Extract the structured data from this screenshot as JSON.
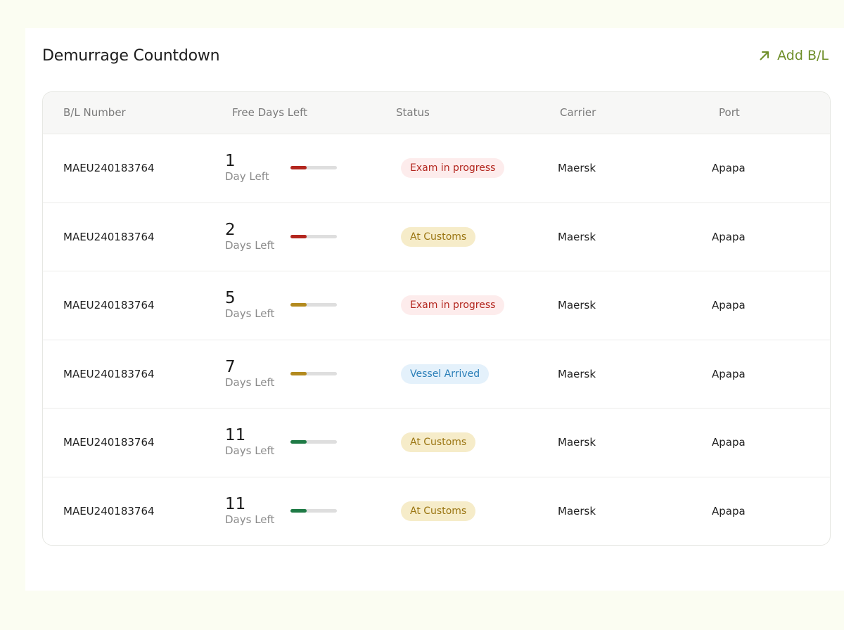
{
  "header": {
    "title": "Demurrage Countdown",
    "add_label": "Add B/L",
    "add_icon": "arrow-up-right-icon"
  },
  "table": {
    "columns": [
      "B/L Number",
      "Free Days Left",
      "Status",
      "Carrier",
      "Port"
    ],
    "rows": [
      {
        "bl": "MAEU240183764",
        "days": "1",
        "days_label": "Day Left",
        "progress": 0.35,
        "bar_color": "#b3261e",
        "status": "Exam in progress",
        "status_type": "exam",
        "carrier": "Maersk",
        "port": "Apapa"
      },
      {
        "bl": "MAEU240183764",
        "days": "2",
        "days_label": "Days Left",
        "progress": 0.35,
        "bar_color": "#b3261e",
        "status": "At Customs",
        "status_type": "customs",
        "carrier": "Maersk",
        "port": "Apapa"
      },
      {
        "bl": "MAEU240183764",
        "days": "5",
        "days_label": "Days Left",
        "progress": 0.35,
        "bar_color": "#b38a1e",
        "status": "Exam in progress",
        "status_type": "exam",
        "carrier": "Maersk",
        "port": "Apapa"
      },
      {
        "bl": "MAEU240183764",
        "days": "7",
        "days_label": "Days Left",
        "progress": 0.35,
        "bar_color": "#b38a1e",
        "status": "Vessel Arrived",
        "status_type": "vessel",
        "carrier": "Maersk",
        "port": "Apapa"
      },
      {
        "bl": "MAEU240183764",
        "days": "11",
        "days_label": "Days Left",
        "progress": 0.35,
        "bar_color": "#1e7a45",
        "status": "At Customs",
        "status_type": "customs",
        "carrier": "Maersk",
        "port": "Apapa"
      },
      {
        "bl": "MAEU240183764",
        "days": "11",
        "days_label": "Days Left",
        "progress": 0.35,
        "bar_color": "#1e7a45",
        "status": "At Customs",
        "status_type": "customs",
        "carrier": "Maersk",
        "port": "Apapa"
      }
    ]
  },
  "status_styles": {
    "exam": {
      "bg": "#fdecec",
      "fg": "#b3261e"
    },
    "customs": {
      "bg": "#f6ecc9",
      "fg": "#9a7512"
    },
    "vessel": {
      "bg": "#e4f1fb",
      "fg": "#2b7fb8"
    }
  },
  "colors": {
    "accent": "#6f8f2a",
    "bar_track": "#dedede"
  }
}
